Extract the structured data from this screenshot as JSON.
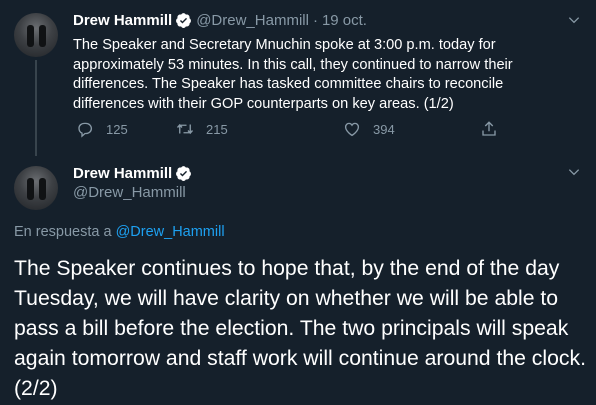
{
  "tweet1": {
    "name": "Drew Hammill",
    "handle": "@Drew_Hammill",
    "separator": "·",
    "date": "19 oct.",
    "text": "The Speaker and Secretary Mnuchin spoke at 3:00 p.m. today for approximately 53 minutes. In this call, they continued to narrow their differences. The Speaker has tasked committee chairs to reconcile differences with their GOP counterparts on key areas. (1/2)",
    "replies": "125",
    "retweets": "215",
    "likes": "394"
  },
  "tweet2": {
    "name": "Drew Hammill",
    "handle": "@Drew_Hammill",
    "reply_prefix": "En respuesta a ",
    "reply_to": "@Drew_Hammill",
    "text": "The Speaker continues to hope that, by the end of the day Tuesday, we will have clarity on whether we will be able to pass a bill before the election. The two principals will speak again tomorrow and staff work will continue around the clock. (2/2)"
  },
  "icons": {
    "verified": "verified-badge-icon",
    "chevron": "chevron-down-icon",
    "reply": "reply-icon",
    "retweet": "retweet-icon",
    "like": "heart-icon",
    "share": "share-icon"
  },
  "colors": {
    "background": "#15202b",
    "text": "#ffffff",
    "muted": "#8899a6",
    "accent": "#1da1f2",
    "thread_line": "#38444d"
  }
}
